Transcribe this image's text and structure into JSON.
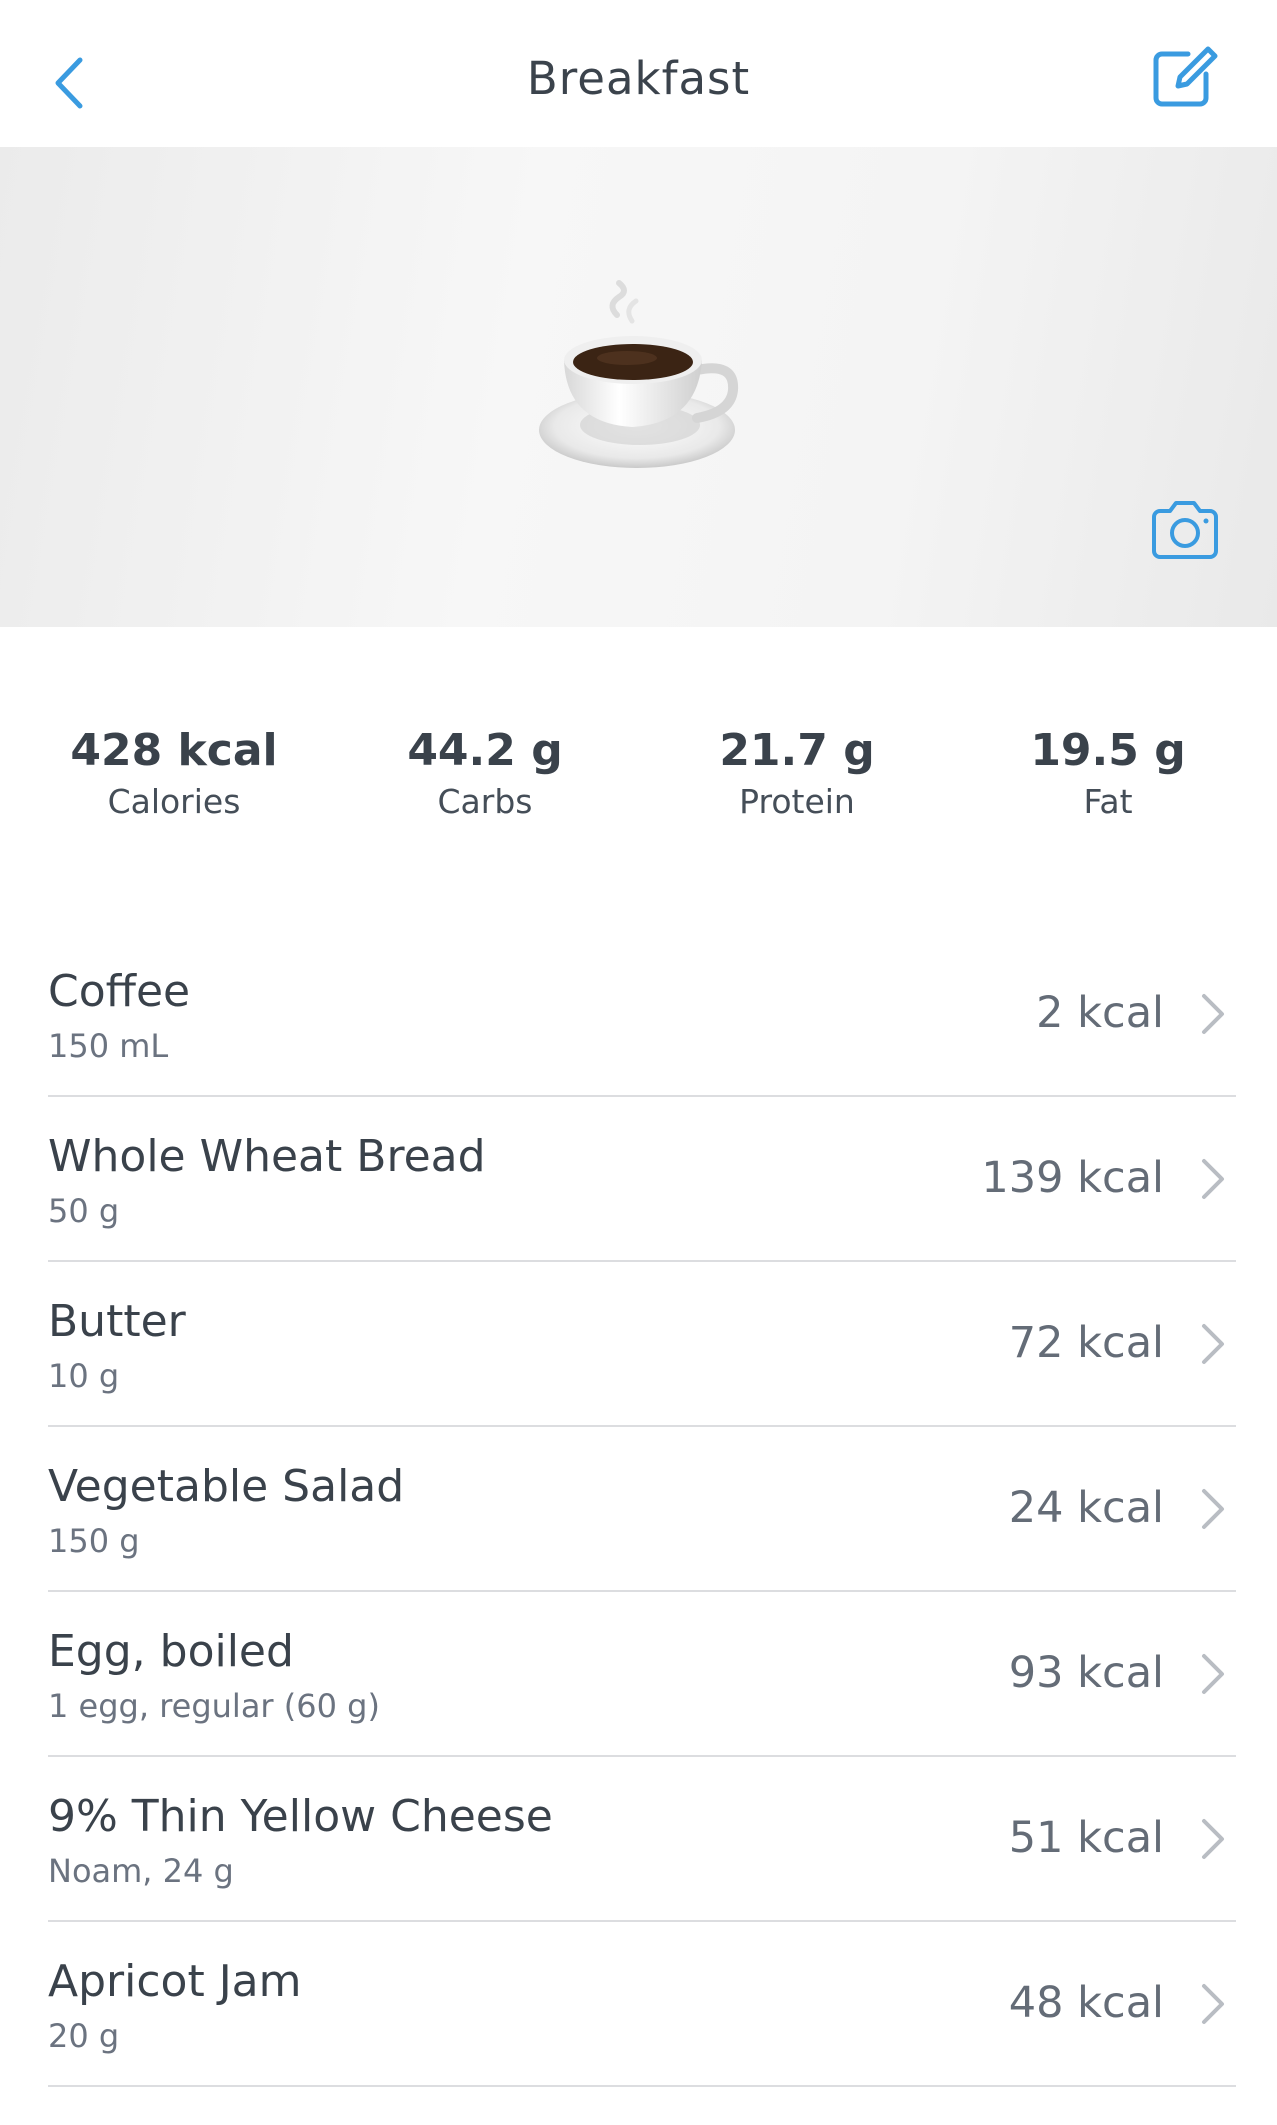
{
  "header": {
    "title": "Breakfast",
    "back_icon": "chevron-left-icon",
    "edit_icon": "edit-icon"
  },
  "hero": {
    "emoji": "coffee-cup-emoji",
    "camera_icon": "camera-icon"
  },
  "macros": [
    {
      "value": "428 kcal",
      "label": "Calories"
    },
    {
      "value": "44.2 g",
      "label": "Carbs"
    },
    {
      "value": "21.7 g",
      "label": "Protein"
    },
    {
      "value": "19.5 g",
      "label": "Fat"
    }
  ],
  "items": [
    {
      "name": "Coffee",
      "amount": "150 mL",
      "kcal": "2 kcal"
    },
    {
      "name": "Whole Wheat Bread",
      "amount": "50 g",
      "kcal": "139 kcal"
    },
    {
      "name": "Butter",
      "amount": "10 g",
      "kcal": "72 kcal"
    },
    {
      "name": "Vegetable Salad",
      "amount": "150 g",
      "kcal": "24 kcal"
    },
    {
      "name": "Egg, boiled",
      "amount": "1 egg, regular (60 g)",
      "kcal": "93 kcal"
    },
    {
      "name": "9% Thin Yellow Cheese",
      "amount": "Noam, 24 g",
      "kcal": "51 kcal"
    },
    {
      "name": "Apricot Jam",
      "amount": "20 g",
      "kcal": "48 kcal"
    }
  ],
  "colors": {
    "accent": "#3a9be0",
    "text_primary": "#3a424b",
    "text_secondary": "#6b7380",
    "divider": "#dcdde0",
    "chevron": "#b9bdc3"
  }
}
